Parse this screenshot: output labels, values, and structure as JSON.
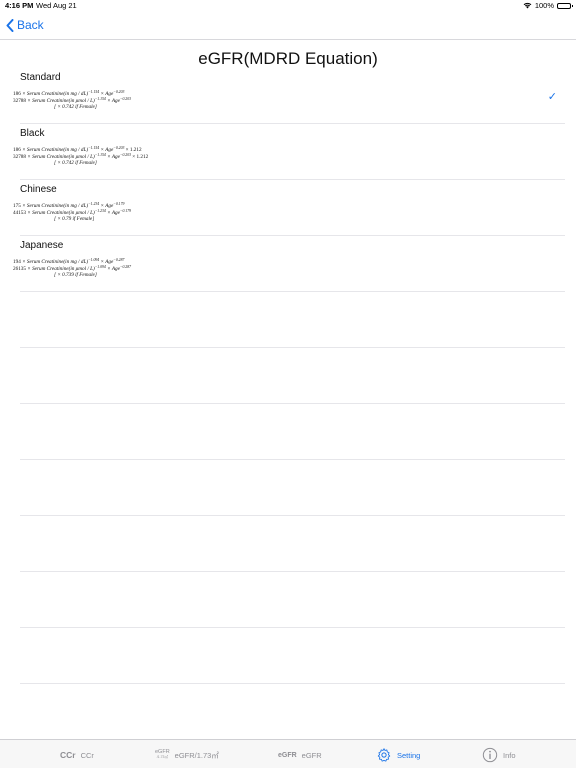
{
  "status": {
    "time": "4:16 PM",
    "date": "Wed Aug 21",
    "battery": "100%"
  },
  "nav": {
    "back_label": "Back"
  },
  "page": {
    "title": "eGFR(MDRD Equation)"
  },
  "options": [
    {
      "label": "Standard",
      "selected": true,
      "line1": {
        "coef": "186",
        "text": " × Serum Creatinine(in mg / dL)",
        "exp1": "−1.154",
        "mid": " × Age",
        "exp2": "−0.203",
        "tail": ""
      },
      "line2": {
        "coef": "32788",
        "text": " × Serum Creatinine(in μmol / L)",
        "exp1": "−1.154",
        "mid": " × Age",
        "exp2": "−0.203",
        "tail": ""
      },
      "line3": "[ × 0.742 if Female]"
    },
    {
      "label": "Black",
      "selected": false,
      "line1": {
        "coef": "186",
        "text": " × Serum Creatinine(in mg / dL)",
        "exp1": "−1.154",
        "mid": " × Age",
        "exp2": "−0.203",
        "tail": " × 1.212"
      },
      "line2": {
        "coef": "32788",
        "text": " × Serum Creatinine(in μmol / L)",
        "exp1": "−1.154",
        "mid": " × Age",
        "exp2": "−0.203",
        "tail": " × 1.212"
      },
      "line3": "[ × 0.742 if Female]"
    },
    {
      "label": "Chinese",
      "selected": false,
      "line1": {
        "coef": "175",
        "text": " × Serum Creatinine(in mg / dL)",
        "exp1": "−1.234",
        "mid": " × Age",
        "exp2": "−0.179",
        "tail": ""
      },
      "line2": {
        "coef": "44153",
        "text": " × Serum Creatinine(in μmol / L)",
        "exp1": "−1.234",
        "mid": " × Age",
        "exp2": "−0.179",
        "tail": ""
      },
      "line3": "[ × 0.79 if Female]"
    },
    {
      "label": "Japanese",
      "selected": false,
      "line1": {
        "coef": "194",
        "text": " × Serum Creatinine(in mg / dL)",
        "exp1": "−1.094",
        "mid": " × Age",
        "exp2": "−0.287",
        "tail": ""
      },
      "line2": {
        "coef": "26135",
        "text": " × Serum Creatinine(in μmol / L)",
        "exp1": "−1.094",
        "mid": " × Age",
        "exp2": "−0.287",
        "tail": ""
      },
      "line3": "[ × 0.739 if Female]"
    }
  ],
  "check_glyph": "✓",
  "tabs": [
    {
      "icon_text": "CCr",
      "label": "CCr",
      "icon_name": "ccr-icon",
      "active": false
    },
    {
      "icon_text": "eGFR",
      "icon_sub": "/1.73㎡",
      "label": "eGFR/1.73㎡",
      "icon_name": "egfr-173-icon",
      "active": false
    },
    {
      "icon_text": "eGFR",
      "label": "eGFR",
      "icon_name": "egfr-icon",
      "active": false
    },
    {
      "label": "Setting",
      "icon_name": "gear-icon",
      "active": true
    },
    {
      "label": "Info",
      "icon_name": "info-icon",
      "active": false
    }
  ],
  "colors": {
    "accent": "#1a73e8",
    "inactive": "#8e8e93",
    "separator": "#e6e6ea"
  }
}
